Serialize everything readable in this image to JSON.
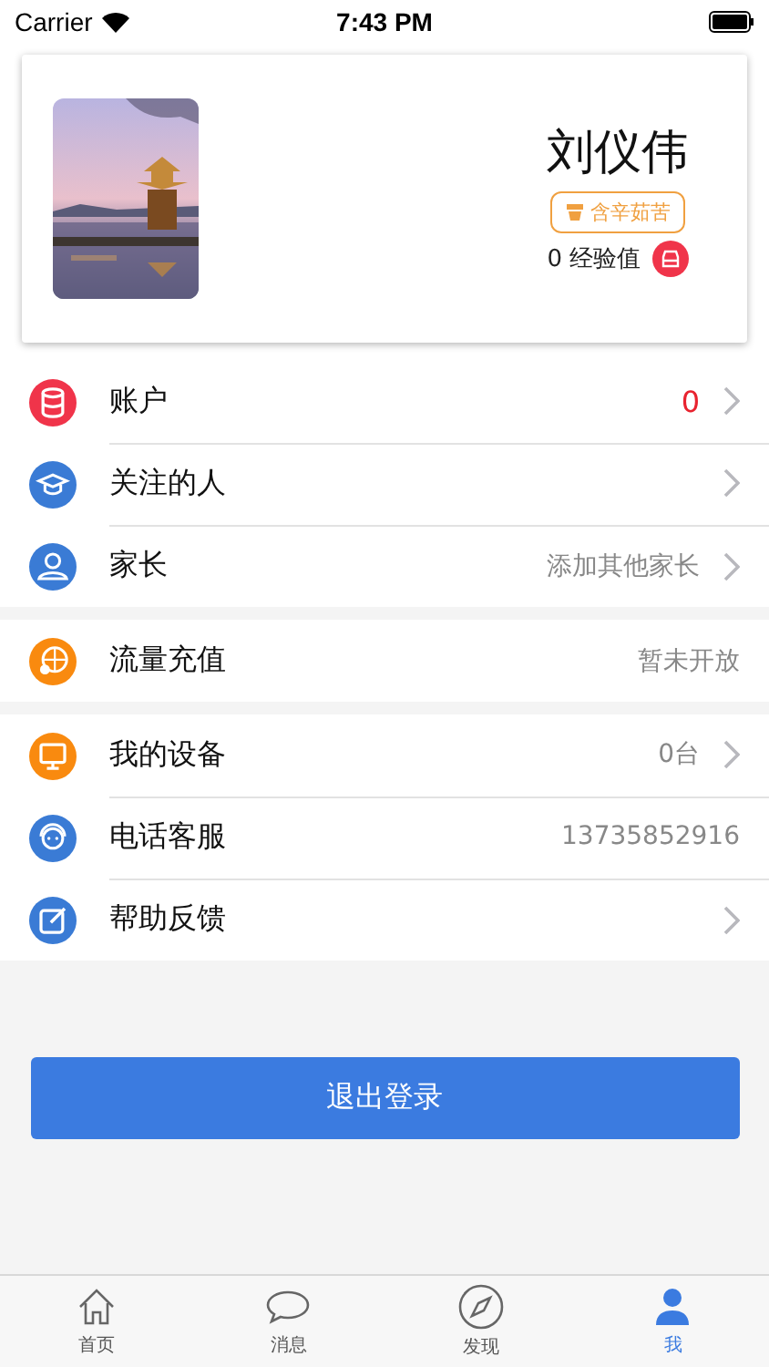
{
  "status_bar": {
    "carrier": "Carrier",
    "time": "7:43 PM"
  },
  "profile": {
    "name": "刘仪伟",
    "badge": "含辛茹苦",
    "experience": "0 经验值"
  },
  "sections": [
    {
      "rows": [
        {
          "kind": "account",
          "color": "#f0344a",
          "label": "账户",
          "value": "0",
          "highlight": true,
          "chevron": true
        },
        {
          "kind": "follow",
          "color": "#3a7bd5",
          "label": "关注的人",
          "chevron": true
        },
        {
          "kind": "parent",
          "color": "#3a7bd5",
          "label": "家长",
          "value": "添加其他家长",
          "highlight": false,
          "chevron": true
        }
      ]
    },
    {
      "rows": [
        {
          "kind": "data",
          "color": "#f98a0f",
          "label": "流量充值",
          "value": "暂未开放",
          "highlight": false,
          "chevron": false
        }
      ]
    },
    {
      "rows": [
        {
          "kind": "device",
          "color": "#f98a0f",
          "label": "我的设备",
          "value": "0台",
          "highlight": false,
          "chevron": true
        },
        {
          "kind": "service",
          "color": "#3a7bd5",
          "label": "电话客服",
          "value": "13735852916",
          "highlight": false,
          "chevron": false
        },
        {
          "kind": "feedback",
          "color": "#3a7bd5",
          "label": "帮助反馈",
          "chevron": true
        }
      ]
    }
  ],
  "logout_button": "退出登录",
  "tab_bar": [
    {
      "kind": "home",
      "label": "首页",
      "selected": false
    },
    {
      "kind": "message",
      "label": "消息",
      "selected": false
    },
    {
      "kind": "discover",
      "label": "发现",
      "selected": false
    },
    {
      "kind": "me",
      "label": "我",
      "selected": true
    }
  ]
}
